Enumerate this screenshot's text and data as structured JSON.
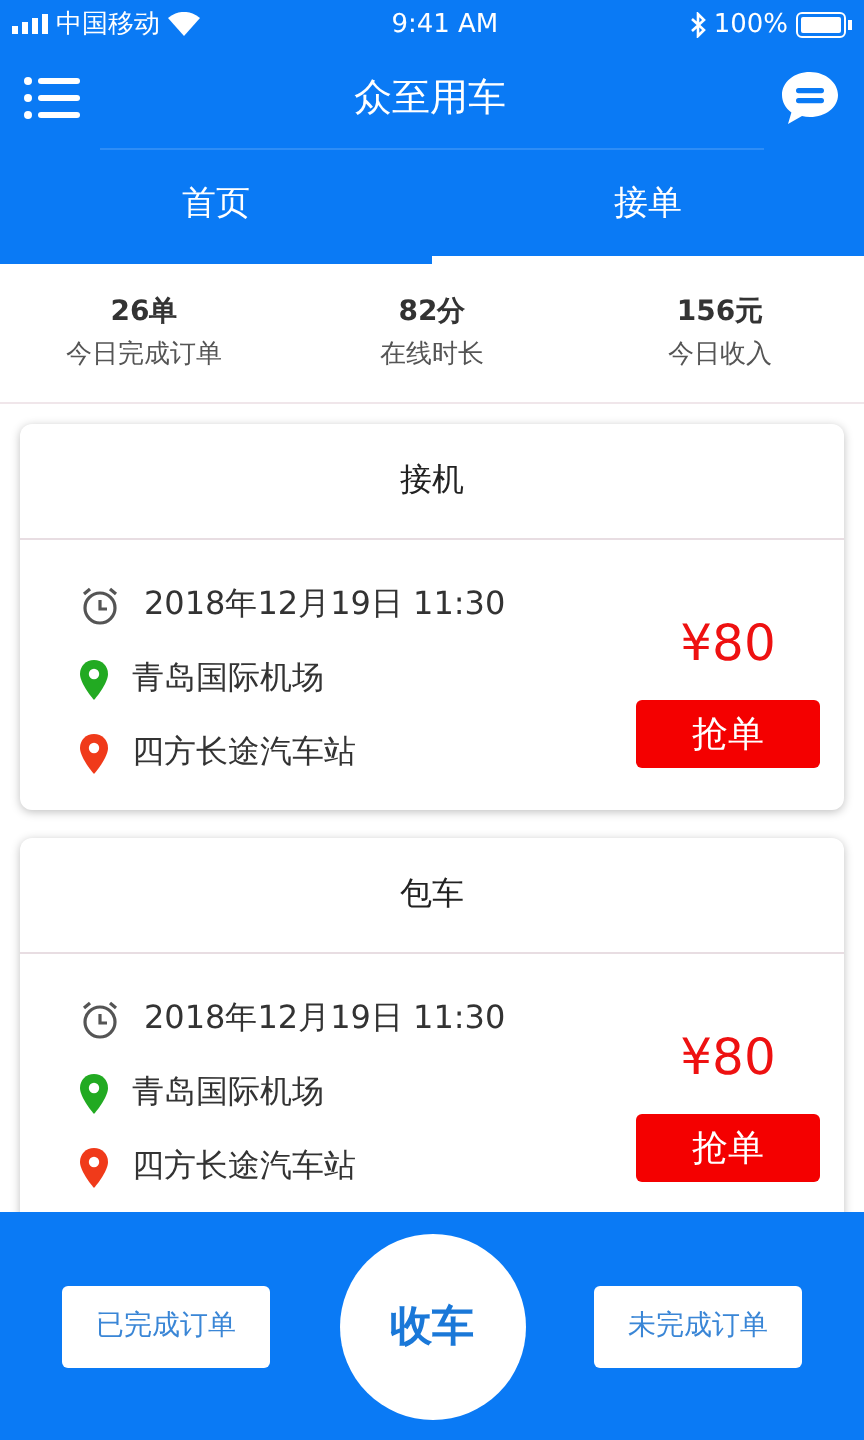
{
  "status_bar": {
    "carrier": "中国移动",
    "time": "9:41 AM",
    "battery": "100%"
  },
  "header": {
    "title": "众至用车"
  },
  "tabs": [
    {
      "label": "首页",
      "selected": false
    },
    {
      "label": "接单",
      "selected": true
    }
  ],
  "stats": [
    {
      "value": "26单",
      "label": "今日完成订单"
    },
    {
      "value": "82分",
      "label": "在线时长"
    },
    {
      "value": "156元",
      "label": "今日收入"
    }
  ],
  "orders": [
    {
      "type": "接机",
      "time": "2018年12月19日 11:30",
      "from": "青岛国际机场",
      "to": "四方长途汽车站",
      "price": "¥80",
      "action": "抢单"
    },
    {
      "type": "包车",
      "time": "2018年12月19日 11:30",
      "from": "青岛国际机场",
      "to": "四方长途汽车站",
      "price": "¥80",
      "action": "抢单"
    }
  ],
  "bottom_bar": {
    "left": "已完成订单",
    "center": "收车",
    "right": "未完成订单"
  }
}
